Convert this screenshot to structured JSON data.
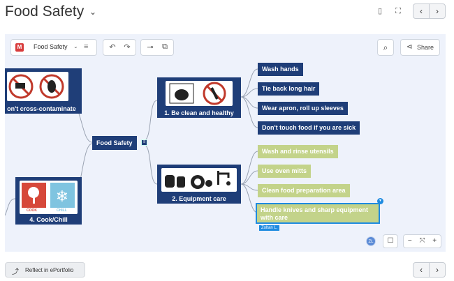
{
  "header": {
    "title": "Food Safety",
    "title_chevron": "⌄",
    "phone_icon": "▯",
    "expand_icon": "⛶",
    "prev": "‹",
    "next": "›"
  },
  "toolbar": {
    "doc_name": "Food Safety",
    "doc_caret": "⌄",
    "menu_icon": "≡",
    "undo": "↶",
    "redo": "↷",
    "add_child": "⊸",
    "add_sibling": "⧉",
    "search_icon": "⌕",
    "share_label": "Share",
    "share_icon": "⊲"
  },
  "map": {
    "center": "Food Safety",
    "branches": [
      {
        "caption": "1. Be clean and healthy",
        "children": [
          "Wash hands",
          "Tie back long hair",
          "Wear apron, roll up sleeves",
          "Don't touch food if you are sick"
        ]
      },
      {
        "caption": "2. Equipment care",
        "children": [
          "Wash and rinse utensils",
          "Use oven mitts",
          "Clean food preparation area",
          "Handle knives and sharp equipment with care"
        ]
      },
      {
        "caption": "on't cross-contaminate"
      },
      {
        "caption": "4. Cook/Chill",
        "labels": {
          "cook": "COOK",
          "chill": "CHILL"
        }
      }
    ],
    "collaborator": "Zoltan L."
  },
  "controls": {
    "avatar": "ZL",
    "comment_icon": "☐",
    "zoom_out": "−",
    "fit": "⤧",
    "zoom_in": "+"
  },
  "footer": {
    "reflect_label": "Reflect in ePortfolio",
    "reflect_icon": "⤴",
    "prev": "‹",
    "next": "›"
  },
  "colors": {
    "node_blue": "#1f3e78",
    "node_green": "#c3d38a",
    "accent": "#1e8be0",
    "canvas_bg": "#eef2fb"
  }
}
